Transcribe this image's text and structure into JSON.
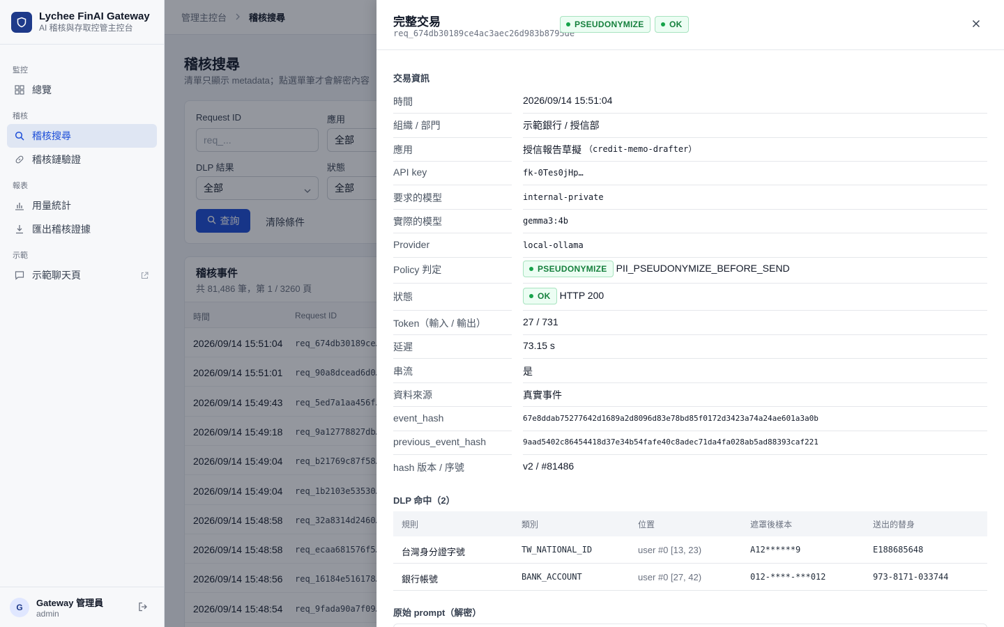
{
  "brand": {
    "title": "Lychee FinAI Gateway",
    "subtitle": "AI 稽核與存取控管主控台"
  },
  "nav": {
    "sections": {
      "monitor": "監控",
      "audit": "稽核",
      "reports": "報表",
      "demo": "示範"
    },
    "items": {
      "overview": "總覽",
      "audit_search": "稽核搜尋",
      "chain_verify": "稽核鏈驗證",
      "usage_stats": "用量統計",
      "export_evidence": "匯出稽核證據",
      "demo_chat": "示範聊天頁"
    }
  },
  "user": {
    "initial": "G",
    "name": "Gateway 管理員",
    "role": "admin"
  },
  "breadcrumb": {
    "root": "管理主控台",
    "current": "稽核搜尋"
  },
  "page": {
    "title": "稽核搜尋",
    "description": "清單只顯示 metadata；點選單筆才會解密內容"
  },
  "filters": {
    "request_id_label": "Request ID",
    "request_id_placeholder": "req_...",
    "app_label": "應用",
    "app_value": "全部",
    "dlp_label": "DLP 結果",
    "dlp_value": "全部",
    "status_label": "狀態",
    "status_value": "全部",
    "search_button": "查詢",
    "clear_button": "清除條件"
  },
  "events": {
    "title": "稽核事件",
    "count": "共 81,486 筆，第 1 / 3260 頁",
    "columns": {
      "time": "時間",
      "request_id": "Request ID"
    },
    "rows": [
      {
        "time": "2026/09/14 15:51:04",
        "id": "req_674db30189ce…"
      },
      {
        "time": "2026/09/14 15:51:01",
        "id": "req_90a8dcead6d0…"
      },
      {
        "time": "2026/09/14 15:49:43",
        "id": "req_5ed7a1aa456f…"
      },
      {
        "time": "2026/09/14 15:49:18",
        "id": "req_9a12778827db…"
      },
      {
        "time": "2026/09/14 15:49:04",
        "id": "req_b21769c87f58…"
      },
      {
        "time": "2026/09/14 15:49:04",
        "id": "req_1b2103e53530…"
      },
      {
        "time": "2026/09/14 15:48:58",
        "id": "req_32a8314d2460…"
      },
      {
        "time": "2026/09/14 15:48:58",
        "id": "req_ecaa681576f5…"
      },
      {
        "time": "2026/09/14 15:48:56",
        "id": "req_16184e516178…"
      },
      {
        "time": "2026/09/14 15:48:54",
        "id": "req_9fada90a7f09…"
      }
    ]
  },
  "drawer": {
    "title": "完整交易",
    "request_id": "req_674db30189ce4ac3aec26d983b8795de",
    "badge_policy": "PSEUDONYMIZE",
    "badge_status": "OK",
    "section_info": "交易資訊",
    "fields": {
      "time_label": "時間",
      "time_value": "2026/09/14 15:51:04",
      "org_label": "組織 / 部門",
      "org_value": "示範銀行 / 授信部",
      "app_label": "應用",
      "app_value": "授信報告草擬",
      "app_code": "（credit-memo-drafter）",
      "apikey_label": "API key",
      "apikey_value": "fk-0Tes0jHp…",
      "req_model_label": "要求的模型",
      "req_model_value": "internal-private",
      "act_model_label": "實際的模型",
      "act_model_value": "gemma3:4b",
      "provider_label": "Provider",
      "provider_value": "local-ollama",
      "policy_label": "Policy 判定",
      "policy_badge": "PSEUDONYMIZE",
      "policy_value": "PII_PSEUDONYMIZE_BEFORE_SEND",
      "status_label": "狀態",
      "status_badge": "OK",
      "status_value": "HTTP 200",
      "token_label": "Token（輸入 / 輸出）",
      "token_value": "27 / 731",
      "latency_label": "延遲",
      "latency_value": "73.15 s",
      "stream_label": "串流",
      "stream_value": "是",
      "source_label": "資料來源",
      "source_value": "真實事件",
      "event_hash_label": "event_hash",
      "event_hash_value": "67e8ddab75277642d1689a2d8096d83e78bd85f0172d3423a74a24ae601a3a0b",
      "prev_hash_label": "previous_event_hash",
      "prev_hash_value": "9aad5402c86454418d37e34b54fafe40c8adec71da4fa028ab5ad88393caf221",
      "hash_ver_label": "hash 版本 / 序號",
      "hash_ver_value": "v2 / #81486"
    },
    "dlp_title": "DLP 命中（2）",
    "dlp_columns": {
      "rule": "規則",
      "category": "類別",
      "position": "位置",
      "masked": "遮罩後樣本",
      "substitute": "送出的替身"
    },
    "dlp_rows": [
      {
        "rule": "台灣身分證字號",
        "category": "TW_NATIONAL_ID",
        "position": "user #0 [13, 23)",
        "masked": "A12******9",
        "substitute": "E188685648"
      },
      {
        "rule": "銀行帳號",
        "category": "BANK_ACCOUNT",
        "position": "user #0 [27, 42)",
        "masked": "012-****-***012",
        "substitute": "973-8171-033744"
      }
    ],
    "prompt_title": "原始 prompt（解密）"
  },
  "colors": {
    "accent": "#1d4ed8",
    "brand": "#1e3a8a",
    "success": "#15803d",
    "success_bg": "#ecfdf3"
  },
  "icons": [
    "shield-icon",
    "grid-icon",
    "search-icon",
    "link-icon",
    "bar-chart-icon",
    "download-icon",
    "chat-icon",
    "external-link-icon",
    "logout-icon",
    "close-icon",
    "chevron-down-icon",
    "chevron-right-icon"
  ]
}
